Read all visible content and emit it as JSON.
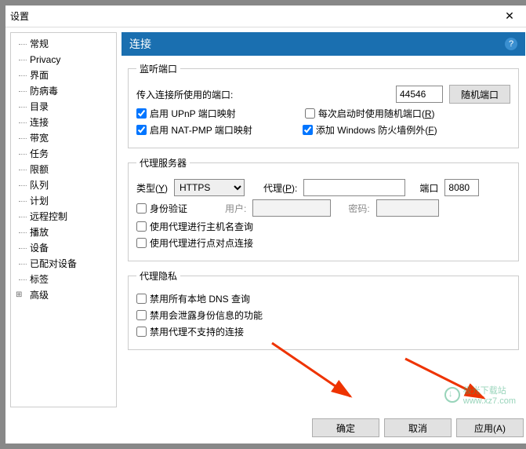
{
  "titlebar": {
    "title": "设置"
  },
  "sidebar": {
    "items": [
      {
        "label": "常规"
      },
      {
        "label": "Privacy"
      },
      {
        "label": "界面"
      },
      {
        "label": "防病毒"
      },
      {
        "label": "目录"
      },
      {
        "label": "连接"
      },
      {
        "label": "带宽"
      },
      {
        "label": "任务"
      },
      {
        "label": "限额"
      },
      {
        "label": "队列"
      },
      {
        "label": "计划"
      },
      {
        "label": "远程控制"
      },
      {
        "label": "播放"
      },
      {
        "label": "设备"
      },
      {
        "label": "已配对设备"
      },
      {
        "label": "标签"
      },
      {
        "label": "高级",
        "expand": true
      }
    ]
  },
  "panel": {
    "title": "连接"
  },
  "listen": {
    "legend": "监听端口",
    "incoming_label": "传入连接所使用的端口:",
    "port": "44546",
    "random_btn": "随机端口",
    "upnp_label": "启用 UPnP 端口映射",
    "random_on_start_label": "每次启动时使用随机端口(R)",
    "natpmp_label": "启用 NAT-PMP 端口映射",
    "firewall_label": "添加 Windows 防火墙例外(F)"
  },
  "proxy": {
    "legend": "代理服务器",
    "type_label": "类型(Y)",
    "type_value": "HTTPS",
    "proxy_label": "代理(P):",
    "proxy_value": "",
    "port_label": "端口",
    "port_value": "8080",
    "auth_label": "身份验证",
    "user_label": "用户:",
    "pass_label": "密码:",
    "hostname_lookup_label": "使用代理进行主机名查询",
    "p2p_label": "使用代理进行点对点连接"
  },
  "privacy": {
    "legend": "代理隐私",
    "dns_label": "禁用所有本地 DNS 查询",
    "leak_label": "禁用会泄露身份信息的功能",
    "unsupported_label": "禁用代理不支持的连接"
  },
  "footer": {
    "ok": "确定",
    "cancel": "取消",
    "apply": "应用(A)"
  },
  "watermark": {
    "text1": "极光下载站",
    "text2": "www.xz7.com"
  }
}
